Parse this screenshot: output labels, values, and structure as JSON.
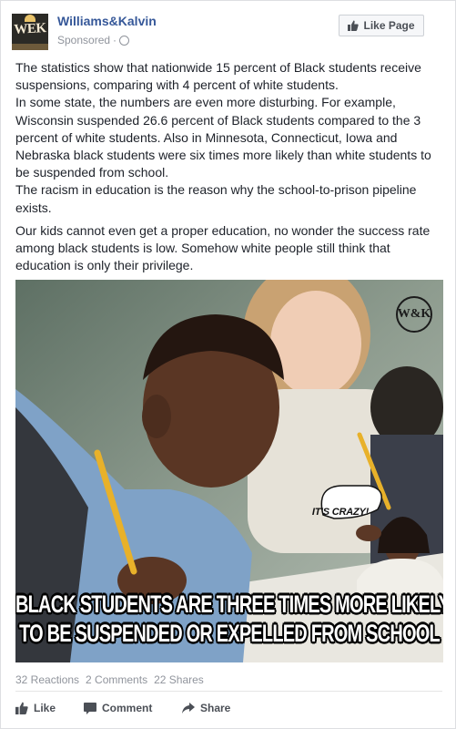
{
  "post": {
    "page_name": "Williams&Kalvin",
    "avatar_text": "WEK",
    "sponsored_label": "Sponsored",
    "separator": "·",
    "like_page_label": "Like Page",
    "paragraphs": [
      "The statistics show that nationwide 15 percent of Black students receive suspensions, comparing with 4 percent of white students.",
      "In some state, the numbers are even more disturbing. For example, Wisconsin suspended 26.6 percent of Black students compared to the 3 percent of white students. Also in Minnesota, Connecticut, Iowa and Nebraska black students were six times more likely than white students to be suspended from school.",
      "The racism in education is the reason why the school-to-prison pipeline exists.",
      "Our kids cannot even get a proper education, no wonder the success rate among black students is low. Somehow white people still think that education is only their privilege."
    ],
    "image": {
      "logo": "W&K",
      "bubble_text": "IT'S CRAZY!",
      "caption_line1": "BLACK STUDENTS ARE THREE TIMES MORE LIKELY",
      "caption_line2": "TO BE SUSPENDED OR EXPELLED FROM SCHOOL"
    },
    "stats": {
      "reactions": "32 Reactions",
      "comments": "2 Comments",
      "shares": "22 Shares"
    },
    "actions": {
      "like": "Like",
      "comment": "Comment",
      "share": "Share"
    }
  },
  "colors": {
    "link_blue": "#365899",
    "meta_gray": "#90949c",
    "action_gray": "#4b4f56",
    "border": "#dddfe2"
  },
  "icons": [
    "globe-icon",
    "thumbs-up-icon",
    "comment-icon",
    "share-arrow-icon"
  ]
}
